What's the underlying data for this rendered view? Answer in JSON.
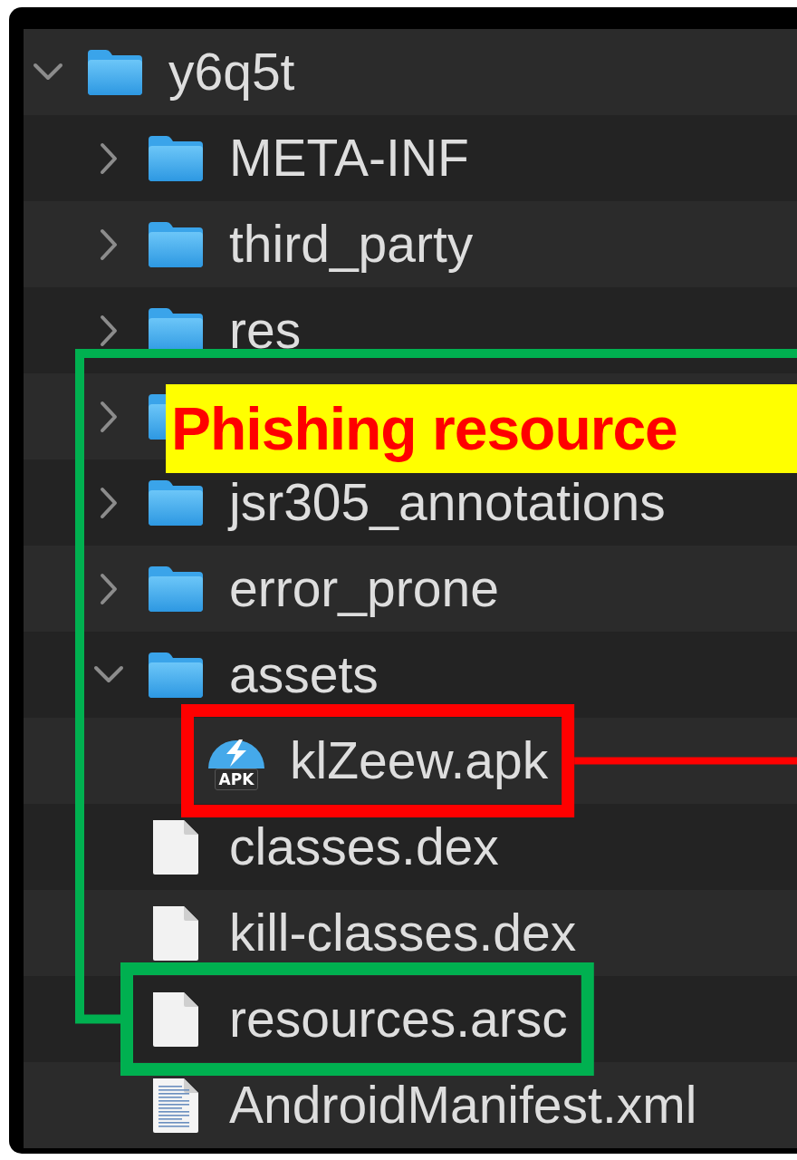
{
  "file_tree": [
    {
      "kind": "folder",
      "name": "y6q5t",
      "expanded": true,
      "children": [
        {
          "kind": "folder",
          "name": "META-INF",
          "expanded": false
        },
        {
          "kind": "folder",
          "name": "third_party",
          "expanded": false
        },
        {
          "kind": "folder",
          "name": "res",
          "expanded": false
        },
        {
          "kind": "folder",
          "expanded": false
        },
        {
          "kind": "folder",
          "name": "jsr305_annotations",
          "expanded": false
        },
        {
          "kind": "folder",
          "name": "error_prone",
          "expanded": false
        },
        {
          "kind": "folder",
          "name": "assets",
          "expanded": true,
          "children": [
            {
              "kind": "apk",
              "name": "klZeew.apk",
              "badge": "APK",
              "color": "#ff0000"
            }
          ]
        },
        {
          "kind": "file",
          "name": "classes.dex"
        },
        {
          "kind": "file",
          "name": "kill-classes.dex"
        },
        {
          "kind": "file",
          "name": "resources.arsc",
          "color": "#00b050"
        },
        {
          "kind": "document",
          "name": "AndroidManifest.xml"
        }
      ]
    }
  ],
  "callout": {
    "text": "Phishing resource"
  }
}
